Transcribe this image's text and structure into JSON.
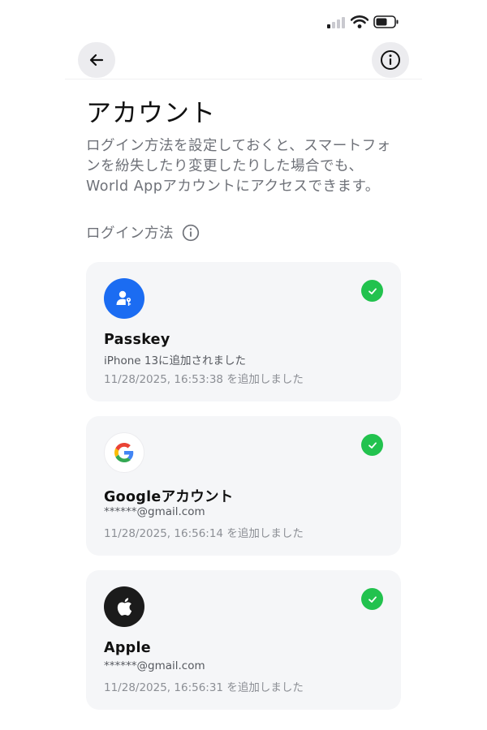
{
  "status_bar": {
    "signal_icon": "cellular-signal-icon",
    "wifi_icon": "wifi-icon",
    "battery_icon": "battery-icon"
  },
  "nav": {
    "back_icon": "arrow-left-icon",
    "info_icon": "info-circle-icon"
  },
  "page": {
    "title": "アカウント",
    "description": "ログイン方法を設定しておくと、スマートフォンを紛失したり変更したりした場合でも、World Appアカウントにアクセスできます。",
    "section_label": "ログイン方法"
  },
  "methods": [
    {
      "icon": "passkey-icon",
      "title": "Passkey",
      "subtitle": "iPhone 13に追加されました",
      "date": "11/28/2025, 16:53:38 を追加しました",
      "status": "check-icon"
    },
    {
      "icon": "google-icon",
      "title": "Googleアカウント",
      "subtitle": "******@gmail.com",
      "date": "11/28/2025, 16:56:14 を追加しました",
      "status": "check-icon"
    },
    {
      "icon": "apple-icon",
      "title": "Apple",
      "subtitle": "******@gmail.com",
      "date": "11/28/2025, 16:56:31 を追加しました",
      "status": "check-icon"
    }
  ],
  "colors": {
    "accent_blue": "#1b6cf2",
    "success_green": "#22c24e",
    "card_background": "#f5f6f8",
    "secondary_text": "#6e7178"
  }
}
